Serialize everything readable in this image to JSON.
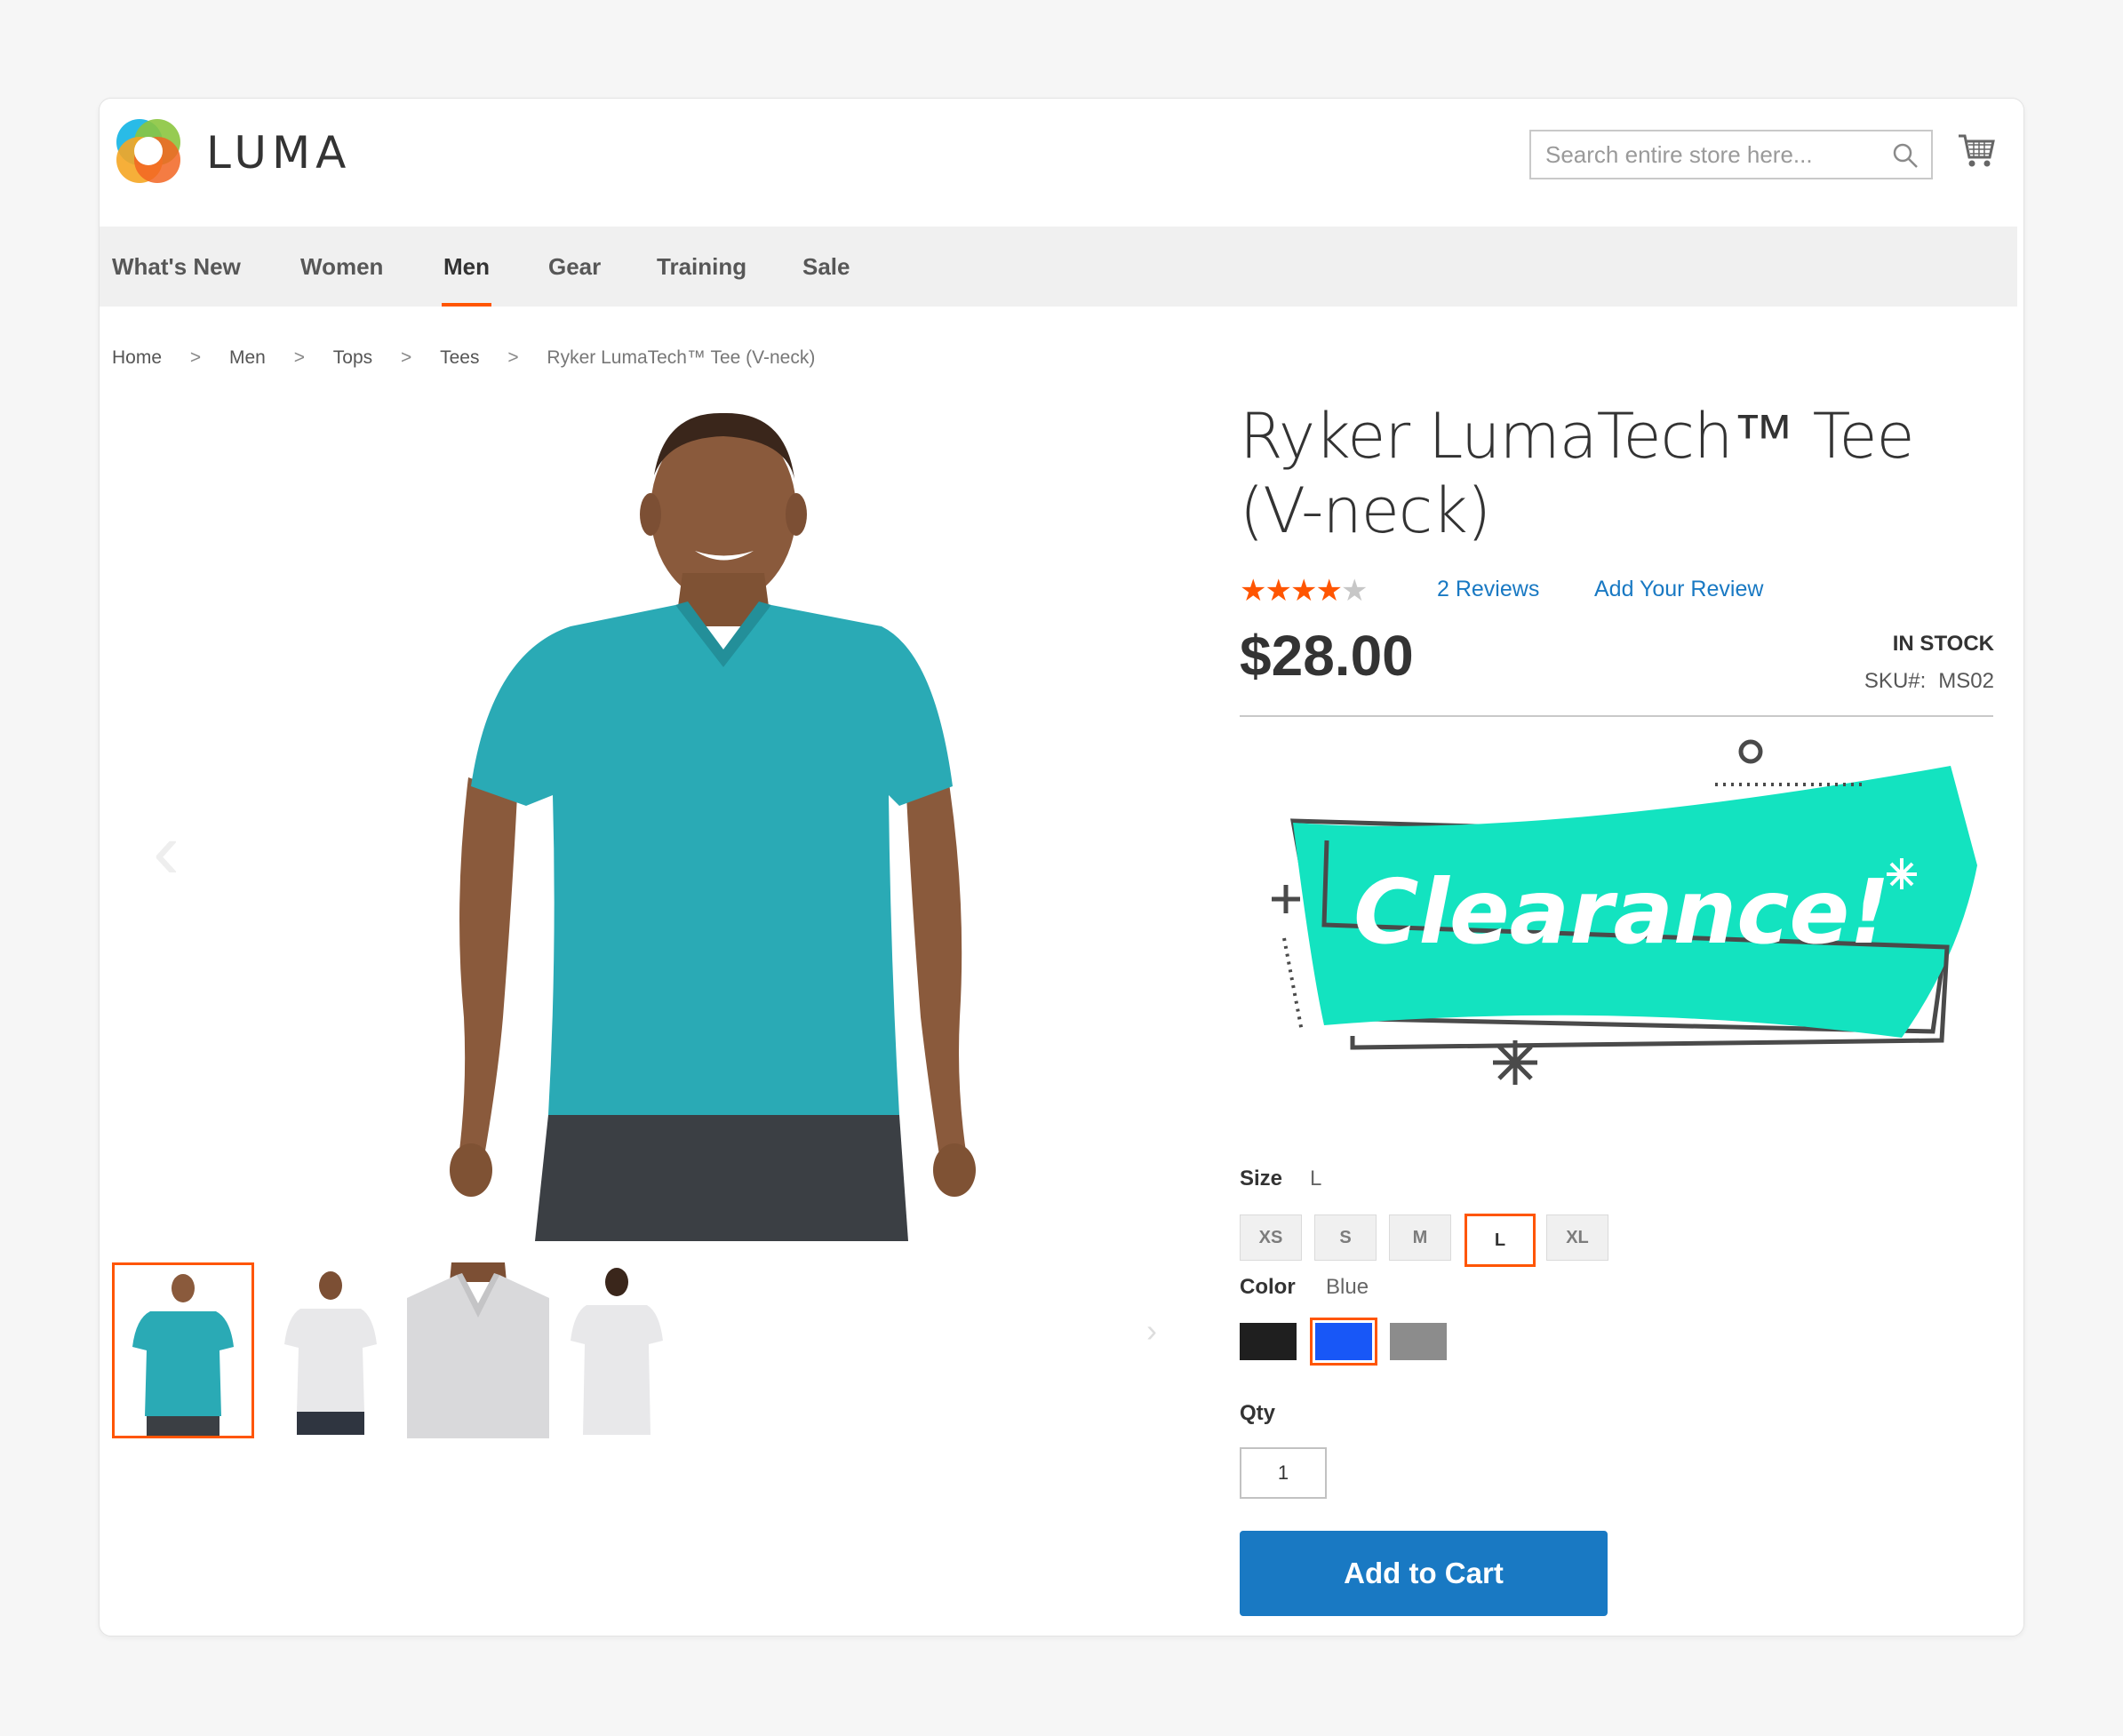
{
  "header": {
    "brand": "LUMA",
    "search_placeholder": "Search entire store here..."
  },
  "nav": {
    "items": [
      "What's New",
      "Women",
      "Men",
      "Gear",
      "Training",
      "Sale"
    ],
    "active": "Men"
  },
  "breadcrumb": {
    "items": [
      "Home",
      "Men",
      "Tops",
      "Tees",
      "Ryker LumaTech™ Tee (V-neck)"
    ],
    "separator": ">"
  },
  "product": {
    "title": "Ryker LumaTech™ Tee (V-neck)",
    "rating_stars": 4.5,
    "reviews_link": "2 Reviews",
    "add_review_link": "Add Your Review",
    "price": "$28.00",
    "stock": "IN STOCK",
    "sku_label": "SKU#:",
    "sku": "MS02",
    "banner_text": "Clearance!"
  },
  "options": {
    "size_label": "Size",
    "size_selected": "L",
    "sizes": [
      "XS",
      "S",
      "M",
      "L",
      "XL"
    ],
    "color_label": "Color",
    "color_selected": "Blue",
    "colors": [
      {
        "name": "black",
        "hex": "#1f1f1f"
      },
      {
        "name": "blue",
        "hex": "#1857f7"
      },
      {
        "name": "gray",
        "hex": "#8c8c8c"
      }
    ],
    "qty_label": "Qty",
    "qty_value": "1"
  },
  "actions": {
    "add_to_cart": "Add to Cart"
  },
  "colors": {
    "accent": "#ff5501",
    "link": "#1979c3",
    "button": "#1979c3",
    "tee": "#2aaab5",
    "banner": "#13e3c0"
  }
}
